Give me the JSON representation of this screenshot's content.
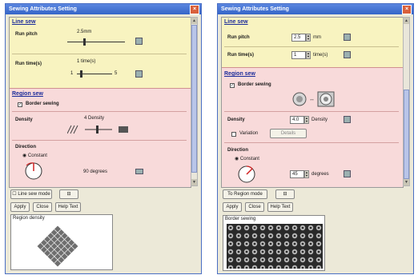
{
  "winA": {
    "title": "Sewing Attributes Setting",
    "line_section_title": "Line sew",
    "row1_label": "Run pitch",
    "row1_value": "2.5mm",
    "row2_label": "Run time(s)",
    "row2_value": "1 time(s)",
    "row2_min": "1",
    "row2_max": "5",
    "region_title": "Region sew",
    "border_label": "Border sewing",
    "density_label": "Density",
    "density_value": "4 Density",
    "direction_label": "Direction",
    "direction_option": "Constant",
    "direction_value": "90 degrees",
    "preview_label": "Region density",
    "bottom_btn1": "Line sew mode",
    "apply": "Apply",
    "close": "Close",
    "help": "Help Text"
  },
  "winB": {
    "title": "Sewing Attributes Setting",
    "line_section_title": "Line sew",
    "row1_label": "Run pitch",
    "row1_value": "2.5",
    "row1_unit": "mm",
    "row2_label": "Run time(s)",
    "row2_value": "1",
    "row2_unit": "time(s)",
    "region_title": "Region sew",
    "border_label": "Border sewing",
    "density_label": "Density",
    "density_value": "4.0",
    "density_unit": "Density",
    "variation_label": "Variation",
    "variation_btn": "Details",
    "direction_label": "Direction",
    "direction_option": "Constant",
    "direction_value": "45",
    "direction_unit": "degrees",
    "bottom_btn1": "To Region mode",
    "apply": "Apply",
    "close": "Close",
    "help": "Help Text",
    "preview_label": "Border sewing"
  }
}
